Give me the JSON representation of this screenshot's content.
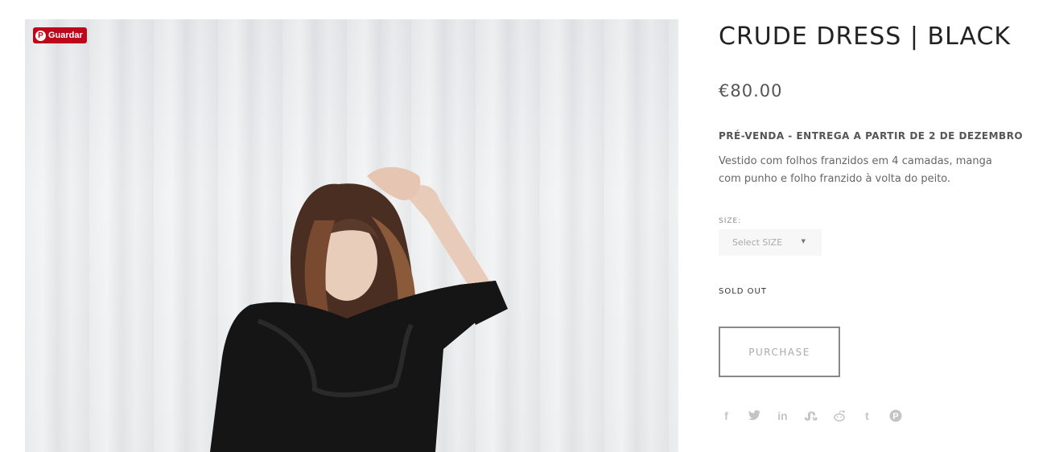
{
  "pin_button": {
    "label": "Guardar",
    "icon": "pinterest-icon",
    "color": "#bd081c"
  },
  "product": {
    "title": "CRUDE DRESS | BLACK",
    "price": "€80.00",
    "preorder": "PRÉ-VENDA - ENTREGA A PARTIR DE 2 DE DEZEMBRO",
    "description": "Vestido com folhos franzidos em 4 camadas, manga com punho e folho franzido à volta do peito."
  },
  "size": {
    "label": "SIZE:",
    "placeholder": "Select SIZE"
  },
  "stock_status": "SOLD OUT",
  "purchase_label": "PURCHASE",
  "share_icons": [
    "facebook-icon",
    "twitter-icon",
    "linkedin-icon",
    "stumbleupon-icon",
    "reddit-icon",
    "tumblr-icon",
    "pinterest-icon"
  ]
}
